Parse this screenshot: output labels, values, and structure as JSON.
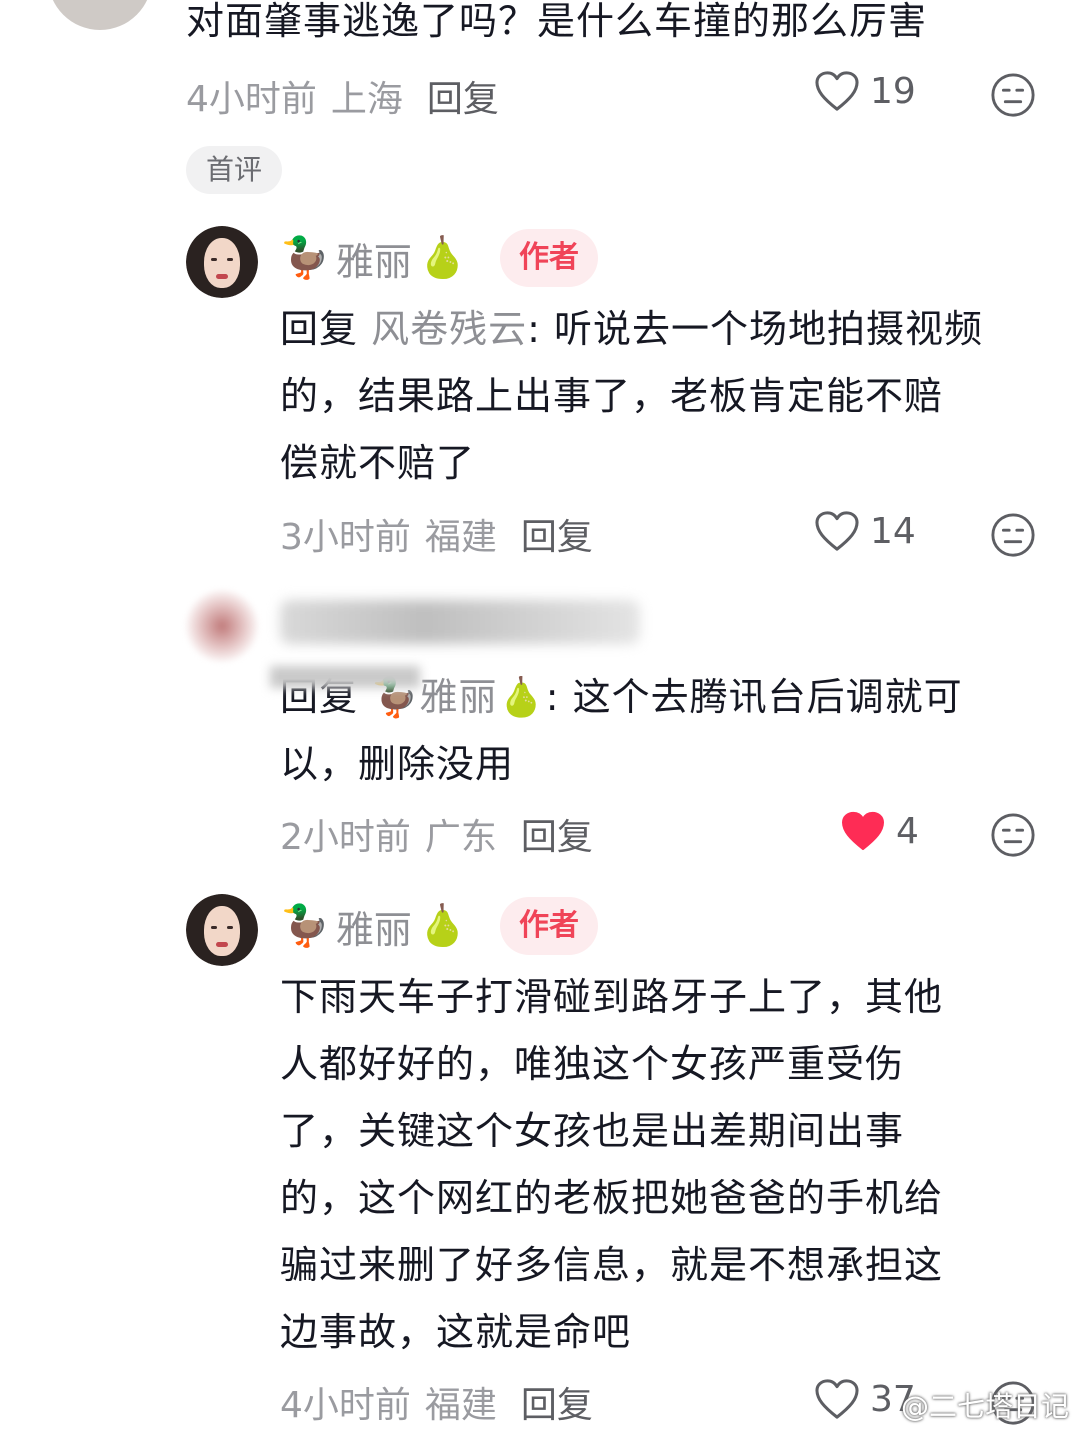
{
  "comment_top": {
    "text": "对面肇事逃逸了吗？是什么车撞的那么厉害",
    "time": "4小时前",
    "region": "上海",
    "reply_label": "回复",
    "likes": "19",
    "tag": "首评"
  },
  "reply1": {
    "emoji_left": "🦆",
    "username": "雅丽",
    "emoji_right": "🍐",
    "badge": "作者",
    "reply_prefix": "回复",
    "reply_to": "风卷残云",
    "line1": ": 听说去一个场地拍摄视频",
    "line2": "的，结果路上出事了，老板肯定能不赔",
    "line3": "偿就不赔了",
    "time": "3小时前",
    "region": "福建",
    "reply_label": "回复",
    "likes": "14"
  },
  "reply2": {
    "reply_prefix": "回复",
    "mention_emoji_left": "🦆",
    "mention_name": "雅丽",
    "mention_emoji_right": "🍐",
    "line1": ": 这个去腾讯台后调就可",
    "line2": "以，删除没用",
    "time": "2小时前",
    "region": "广东",
    "reply_label": "回复",
    "likes": "4",
    "liked_color": "#fe2c55"
  },
  "reply3": {
    "emoji_left": "🦆",
    "username": "雅丽",
    "emoji_right": "🍐",
    "badge": "作者",
    "lines": [
      "下雨天车子打滑碰到路牙子上了，其他",
      "人都好好的，唯独这个女孩严重受伤",
      "了，关键这个女孩也是出差期间出事",
      "的，这个网红的老板把她爸爸的手机给",
      "骗过来删了好多信息，就是不想承担这",
      "边事故，这就是命吧"
    ],
    "time": "4小时前",
    "region": "福建",
    "reply_label": "回复",
    "likes": "37"
  },
  "watermark": "@二七塔日记",
  "colors": {
    "text": "#161823",
    "meta": "#9a9ba0",
    "badge_bg": "#fdecee",
    "badge_text": "#f04458",
    "like_active": "#fe2c55"
  }
}
